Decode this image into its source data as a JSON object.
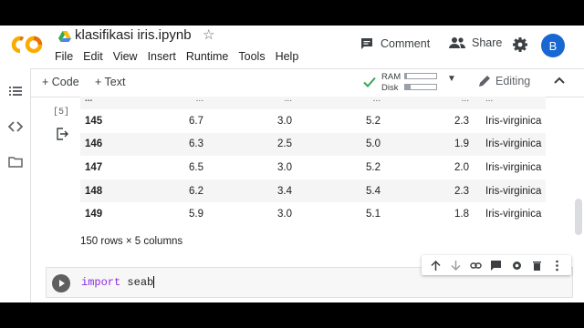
{
  "header": {
    "title": "klasifikasi iris.ipynb",
    "menu": [
      "File",
      "Edit",
      "View",
      "Insert",
      "Runtime",
      "Tools",
      "Help"
    ],
    "comment_label": "Comment",
    "share_label": "Share",
    "avatar_letter": "B"
  },
  "toolbar": {
    "add_code": "+ Code",
    "add_text": "+ Text",
    "ram_label": "RAM",
    "disk_label": "Disk",
    "ram_usage": 0.05,
    "disk_usage": 0.18,
    "editing_label": "Editing"
  },
  "output": {
    "exec_count": "[5]",
    "ellipsis_row": [
      "...",
      "...",
      "...",
      "...",
      "...",
      "..."
    ],
    "rows": [
      [
        "145",
        "6.7",
        "3.0",
        "5.2",
        "2.3",
        "Iris-virginica"
      ],
      [
        "146",
        "6.3",
        "2.5",
        "5.0",
        "1.9",
        "Iris-virginica"
      ],
      [
        "147",
        "6.5",
        "3.0",
        "5.2",
        "2.0",
        "Iris-virginica"
      ],
      [
        "148",
        "6.2",
        "3.4",
        "5.4",
        "2.3",
        "Iris-virginica"
      ],
      [
        "149",
        "5.9",
        "3.0",
        "5.1",
        "1.8",
        "Iris-virginica"
      ]
    ],
    "row_count": "150 rows × 5 columns"
  },
  "code_cell": {
    "keyword": "import",
    "rest": " seab"
  },
  "colors": {
    "accent": "#1967d2",
    "logo_orange": "#f9ab00",
    "logo_dark_orange": "#e8710a",
    "check_green": "#34a853",
    "keyword": "#8a2be2"
  }
}
